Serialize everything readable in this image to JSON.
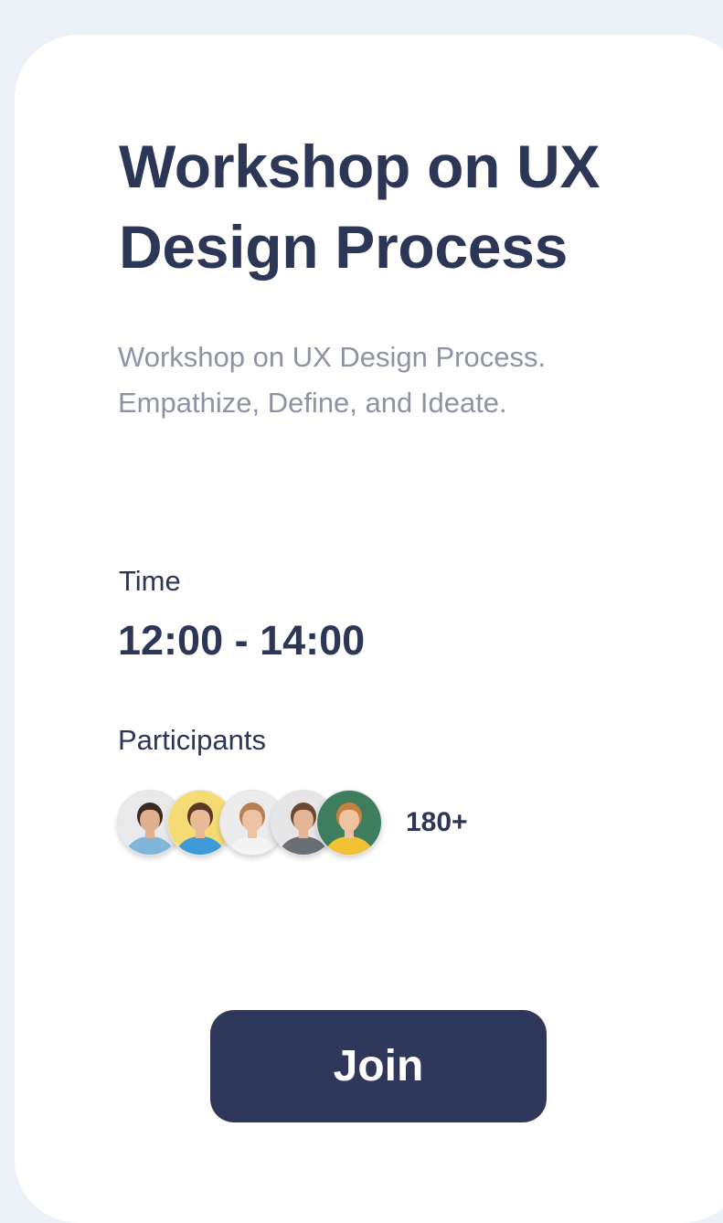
{
  "event": {
    "title": "Workshop on UX Design Process",
    "description": "Workshop on UX Design Process. Empathize, Define, and Ideate.",
    "time_label": "Time",
    "time_value": "12:00 - 14:00",
    "participants_label": "Participants",
    "participants_count": "180+",
    "join_label": "Join"
  },
  "colors": {
    "background": "#ECF0F7",
    "card": "#FFFFFF",
    "heading": "#2C3656",
    "muted_text": "#8E93A3",
    "button": "#2F385B",
    "button_text": "#FFFFFF"
  },
  "avatars": [
    {
      "icon": "person-avatar-bearded-man",
      "bg": "#E9E9EB",
      "shirt": "#7FB6DA",
      "hair": "#3A2A22",
      "skin": "#E0B08F"
    },
    {
      "icon": "person-avatar-smiling-man",
      "bg": "#F4DB73",
      "shirt": "#3E9AD6",
      "hair": "#5A3A23",
      "skin": "#E9BA96"
    },
    {
      "icon": "person-avatar-woman",
      "bg": "#ECECEE",
      "shirt": "#F4F4F4",
      "hair": "#B57F4E",
      "skin": "#EDC3A4"
    },
    {
      "icon": "person-avatar-young-man",
      "bg": "#E6E6E8",
      "shirt": "#6A6F75",
      "hair": "#6B4A33",
      "skin": "#E3B595"
    },
    {
      "icon": "person-avatar-woman-yellow",
      "bg": "#3E7E5E",
      "shirt": "#F2C233",
      "hair": "#C7823F",
      "skin": "#EFC3A0"
    }
  ]
}
